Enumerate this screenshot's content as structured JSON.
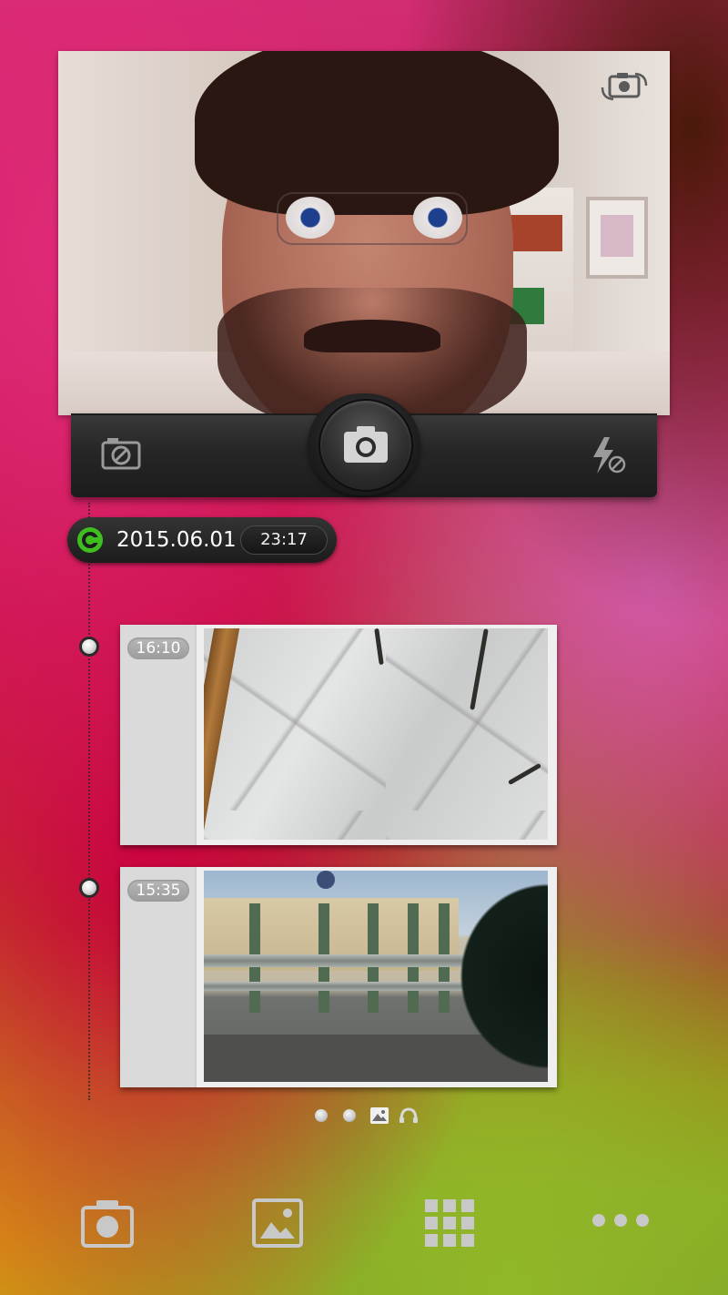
{
  "timeline_header": {
    "date": "2015.06.01",
    "time": "23:17"
  },
  "entries": [
    {
      "time": "16:10"
    },
    {
      "time": "15:35"
    }
  ],
  "colors": {
    "bar_dark": "#262626",
    "live_green": "#3fbf1f",
    "chip_gray": "#a8a8a8"
  },
  "icons": {
    "switch_camera": "switch-camera-icon",
    "disable_camera": "camera-off-icon",
    "shutter": "camera-icon",
    "flash_off": "flash-off-icon",
    "nav_camera": "camera-icon",
    "nav_gallery": "gallery-icon",
    "nav_apps": "app-grid-icon",
    "nav_more": "more-icon"
  }
}
